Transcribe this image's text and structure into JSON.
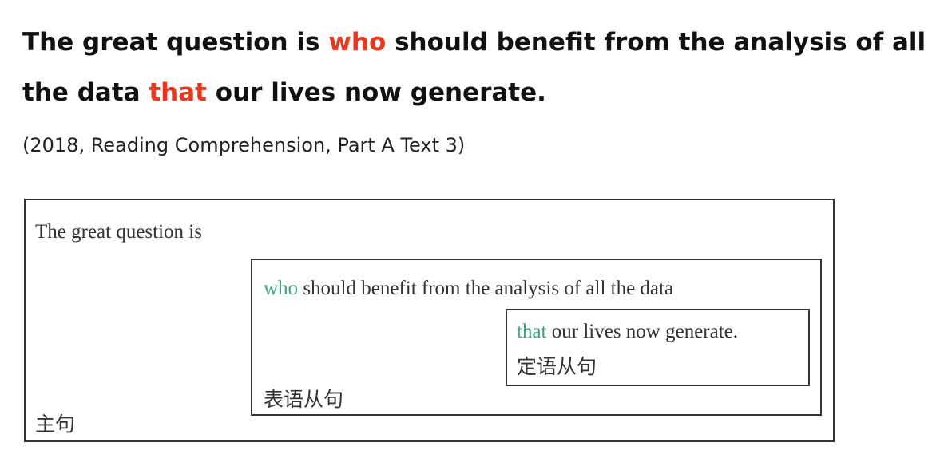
{
  "sentence": {
    "part1": "The great question is ",
    "who": "who",
    "part2": " should benefit from the analysis of all the data ",
    "that": "that",
    "part3": " our lives now generate."
  },
  "source": "(2018, Reading Comprehension, Part A Text 3)",
  "diagram": {
    "main_clause": "The great question is",
    "main_label": "主句",
    "predicative": {
      "who": "who",
      "rest": " should benefit from the analysis of all the data",
      "label": "表语从句"
    },
    "attributive": {
      "that": "that",
      "rest": " our lives now generate.",
      "label": "定语从句"
    }
  },
  "colors": {
    "highlight_red": "#e8371c",
    "highlight_green": "#3aa57a"
  }
}
